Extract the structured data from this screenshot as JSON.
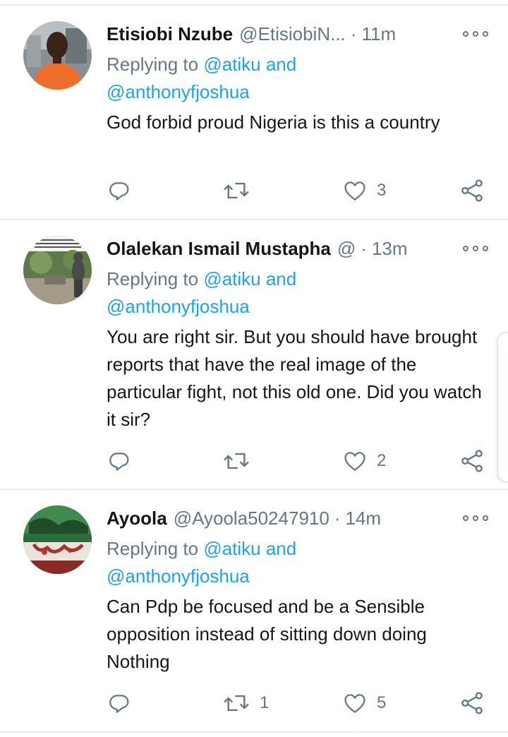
{
  "tweets": [
    {
      "name": "Etisiobi Nzube",
      "handle": "@EtisiobiN...",
      "time": "11m",
      "reply_prefix": "Replying to",
      "reply_mention1": "@atiku and",
      "reply_mention2": "@anthonyfjoshua",
      "text": "God forbid proud Nigeria is this a country",
      "retweets": "",
      "likes": "3"
    },
    {
      "name": "Olalekan Ismail Mustapha",
      "handle": "@",
      "time": "13m",
      "reply_prefix": "Replying to",
      "reply_mention1": "@atiku and",
      "reply_mention2": "@anthonyfjoshua",
      "text": "You are right sir. But you should have brought reports that have the real image of the particular fight, not this old one. Did you watch it sir?",
      "retweets": "",
      "likes": "2"
    },
    {
      "name": "Ayoola",
      "handle": "@Ayoola50247910",
      "time": "14m",
      "reply_prefix": "Replying to",
      "reply_mention1": "@atiku and",
      "reply_mention2": "@anthonyfjoshua",
      "text": "Can Pdp be focused and be a Sensible opposition instead of sitting down doing Nothing",
      "retweets": "1",
      "likes": "5"
    }
  ],
  "icons": {
    "reply": "reply-icon",
    "retweet": "retweet-icon",
    "like": "heart-icon",
    "share": "share-icon",
    "more": "more-options-icon"
  },
  "colors": {
    "link": "#1da1f2",
    "secondary": "#657786",
    "text": "#14171a",
    "separator": "#e6ecf0"
  }
}
